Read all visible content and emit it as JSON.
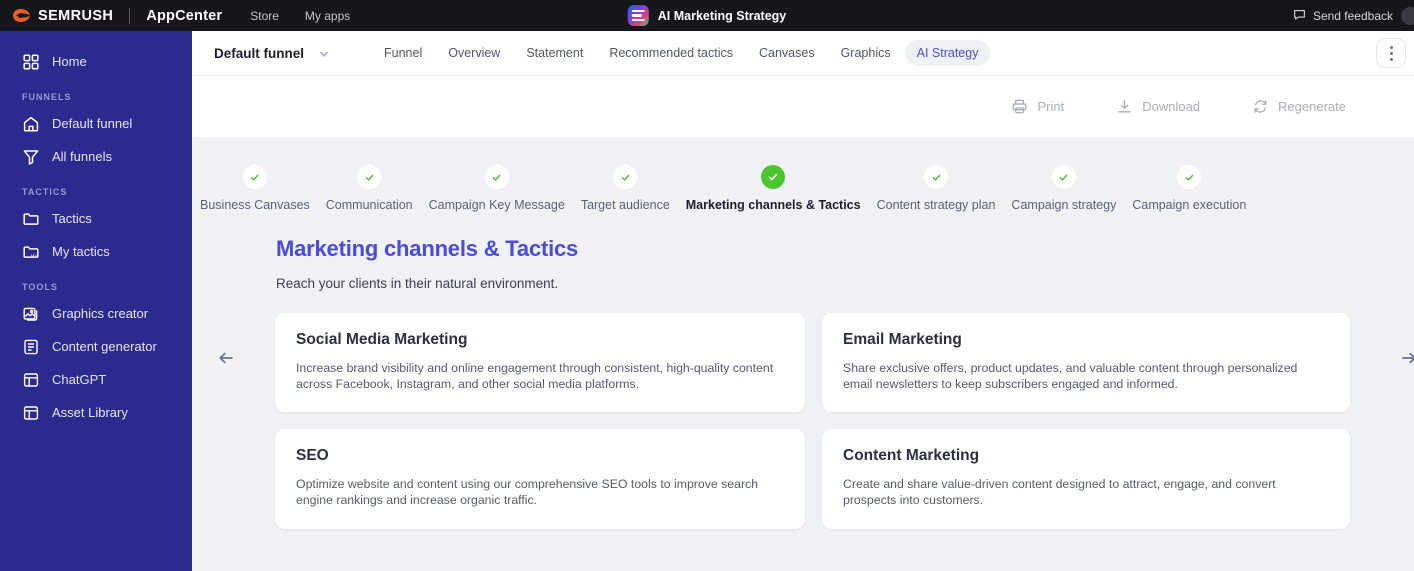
{
  "topbar": {
    "brand": "SEMRUSH",
    "brand_sub": "AppCenter",
    "links": [
      {
        "label": "Store",
        "name": "store"
      },
      {
        "label": "My apps",
        "name": "my-apps"
      }
    ],
    "app_title": "AI Marketing Strategy",
    "feedback_label": "Send feedback"
  },
  "sidebar": {
    "items": [
      {
        "label": "Home",
        "icon": "grid-icon",
        "name": "home"
      }
    ],
    "groups": [
      {
        "title": "FUNNELS",
        "items": [
          {
            "label": "Default funnel",
            "icon": "house-icon",
            "name": "default-funnel"
          },
          {
            "label": "All funnels",
            "icon": "funnel-icon",
            "name": "all-funnels"
          }
        ]
      },
      {
        "title": "TACTICS",
        "items": [
          {
            "label": "Tactics",
            "icon": "folder-icon",
            "name": "tactics"
          },
          {
            "label": "My tactics",
            "icon": "folder-my-icon",
            "name": "my-tactics"
          }
        ]
      },
      {
        "title": "TOOLS",
        "items": [
          {
            "label": "Graphics creator",
            "icon": "image-icon",
            "name": "graphics-creator"
          },
          {
            "label": "Content generator",
            "icon": "document-icon",
            "name": "content-generator"
          },
          {
            "label": "ChatGPT",
            "icon": "layout-icon",
            "name": "chatgpt"
          },
          {
            "label": "Asset Library",
            "icon": "layout-icon",
            "name": "asset-library"
          }
        ]
      }
    ]
  },
  "tabbar": {
    "funnel_name": "Default funnel",
    "tabs": [
      {
        "label": "Funnel",
        "active": false
      },
      {
        "label": "Overview",
        "active": false
      },
      {
        "label": "Statement",
        "active": false
      },
      {
        "label": "Recommended tactics",
        "active": false
      },
      {
        "label": "Canvases",
        "active": false
      },
      {
        "label": "Graphics",
        "active": false
      },
      {
        "label": "AI Strategy",
        "active": true
      }
    ]
  },
  "toolbar": {
    "print_label": "Print",
    "download_label": "Download",
    "regenerate_label": "Regenerate"
  },
  "stepper": {
    "steps": [
      {
        "label": "Business Canvases",
        "state": "done"
      },
      {
        "label": "Communication",
        "state": "done"
      },
      {
        "label": "Campaign Key Message",
        "state": "done"
      },
      {
        "label": "Target audience",
        "state": "done"
      },
      {
        "label": "Marketing channels & Tactics",
        "state": "current"
      },
      {
        "label": "Content strategy plan",
        "state": "done"
      },
      {
        "label": "Campaign strategy",
        "state": "done"
      },
      {
        "label": "Campaign execution",
        "state": "done"
      }
    ]
  },
  "section": {
    "title": "Marketing channels & Tactics",
    "subtitle": "Reach your clients in their natural environment."
  },
  "cards": [
    {
      "title": "Social Media Marketing",
      "body": "Increase brand visibility and online engagement through consistent, high-quality content across Facebook, Instagram, and other social media platforms."
    },
    {
      "title": "Email Marketing",
      "body": "Share exclusive offers, product updates, and valuable content through personalized email newsletters to keep subscribers engaged and informed."
    },
    {
      "title": "SEO",
      "body": "Optimize website and content using our comprehensive SEO tools to improve search engine rankings and increase organic traffic."
    },
    {
      "title": "Content Marketing",
      "body": "Create and share value-driven content designed to attract, engage, and convert prospects into customers."
    }
  ],
  "colors": {
    "sidebar": "#2a2a8f",
    "topbar": "#16161d",
    "accent": "#4a49e0",
    "success": "#49c52d",
    "content_bg": "#f0f1f4"
  }
}
